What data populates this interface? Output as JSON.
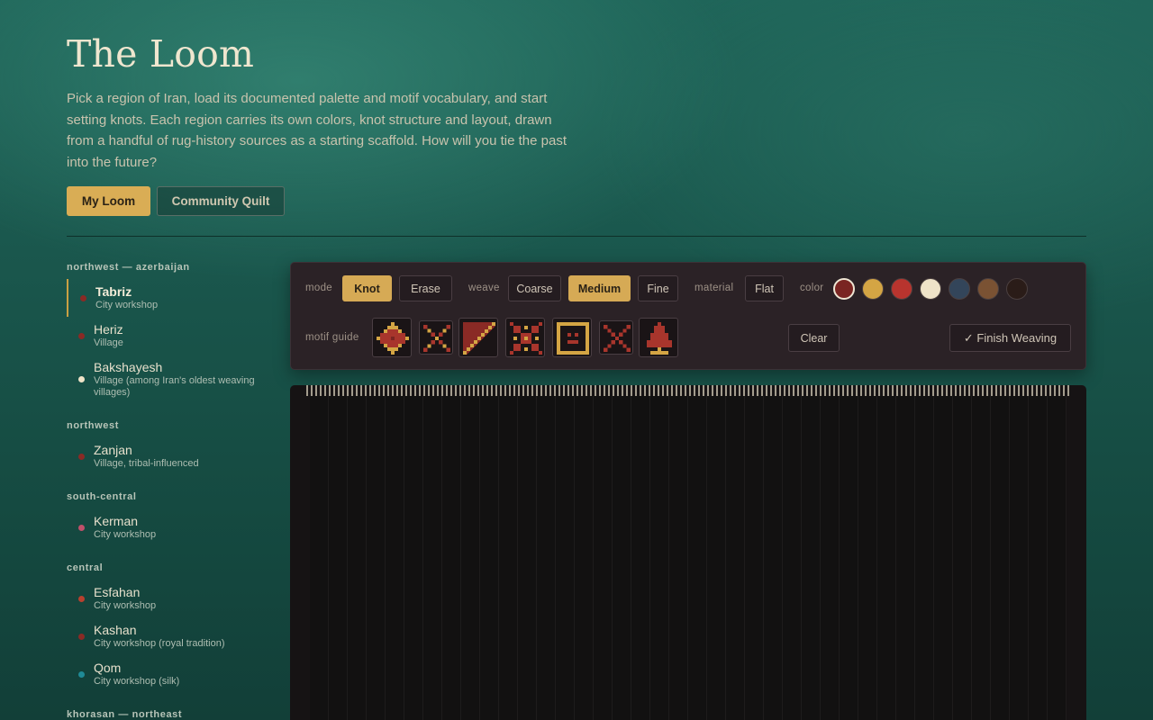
{
  "header": {
    "title": "The Loom",
    "intro": "Pick a region of Iran, load its documented palette and motif vocabulary, and start setting knots. Each region carries its own colors, knot structure and layout, drawn from a handful of rug-history sources as a starting scaffold. How will you tie the past into the future?"
  },
  "nav": {
    "my_loom": "My Loom",
    "community_quilt": "Community Quilt"
  },
  "sidebar": {
    "groups": [
      {
        "label": "northwest — azerbaijan",
        "regions": [
          {
            "name": "Tabriz",
            "sub": "City workshop",
            "color": "#8a2a25",
            "active": true
          },
          {
            "name": "Heriz",
            "sub": "Village",
            "color": "#8a2a25"
          },
          {
            "name": "Bakshayesh",
            "sub": "Village (among Iran's oldest weaving villages)",
            "color": "#efe3c8"
          }
        ]
      },
      {
        "label": "northwest",
        "regions": [
          {
            "name": "Zanjan",
            "sub": "Village, tribal-influenced",
            "color": "#8a2a25"
          }
        ]
      },
      {
        "label": "south-central",
        "regions": [
          {
            "name": "Kerman",
            "sub": "City workshop",
            "color": "#c0506a"
          }
        ]
      },
      {
        "label": "central",
        "regions": [
          {
            "name": "Esfahan",
            "sub": "City workshop",
            "color": "#b8402e"
          },
          {
            "name": "Kashan",
            "sub": "City workshop (royal tradition)",
            "color": "#8a2a25"
          },
          {
            "name": "Qom",
            "sub": "City workshop (silk)",
            "color": "#1f8a96"
          }
        ]
      },
      {
        "label": "khorasan — northeast",
        "regions": []
      }
    ]
  },
  "toolbar": {
    "mode_label": "mode",
    "mode_options": [
      "Knot",
      "Erase"
    ],
    "mode_selected": "Knot",
    "weave_label": "weave",
    "weave_options": [
      "Coarse",
      "Medium",
      "Fine"
    ],
    "weave_selected": "Medium",
    "material_label": "material",
    "material_value": "Flat",
    "color_label": "color",
    "colors": [
      "#7a2522",
      "#d4a544",
      "#b8342e",
      "#efe3c8",
      "#33455a",
      "#7a5233",
      "#2a1c18"
    ],
    "color_selected_index": 0,
    "motif_label": "motif guide",
    "motifs": [
      "medallion-icon",
      "cross-x-icon",
      "corner-spandrel-icon",
      "star-lattice-icon",
      "frame-border-icon",
      "diagonal-x-icon",
      "tree-of-life-icon"
    ],
    "clear_label": "Clear",
    "finish_label": "✓ Finish Weaving"
  }
}
